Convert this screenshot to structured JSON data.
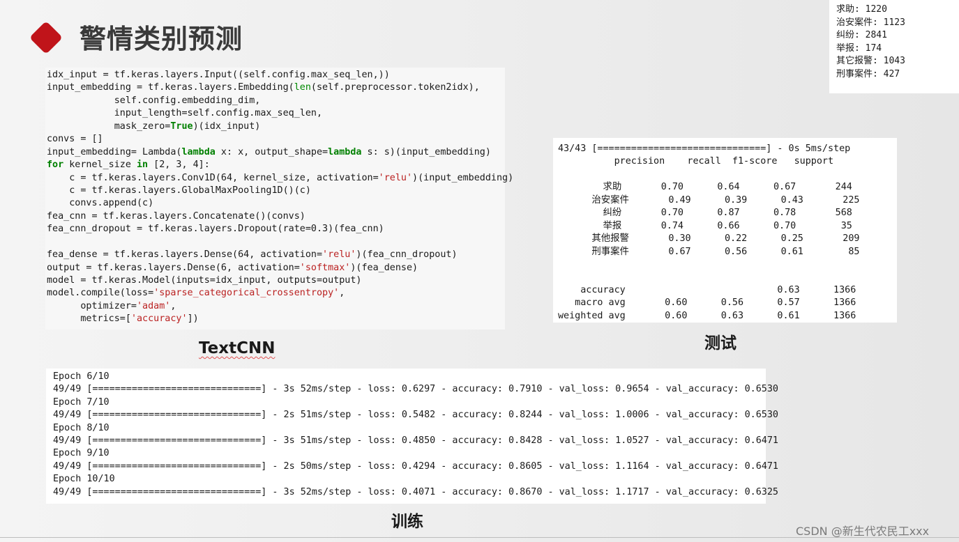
{
  "slide": {
    "title": "警情类别预测",
    "icon": "red-diamond-bullet",
    "accent_color": "#c0141a"
  },
  "class_counts": [
    "求助: 1220",
    "治安案件: 1123",
    "纠纷: 2841",
    "举报: 174",
    "其它报警: 1043",
    "刑事案件: 427"
  ],
  "code_lines": [
    [
      [
        "t",
        "idx_input = tf.keras.layers.Input((self.config.max_seq_len,))"
      ]
    ],
    [
      [
        "t",
        "input_embedding = tf.keras.layers.Embedding("
      ],
      [
        "n",
        "len"
      ],
      [
        "t",
        "(self.preprocessor.token2idx),"
      ]
    ],
    [
      [
        "t",
        "            self.config.embedding_dim,"
      ]
    ],
    [
      [
        "t",
        "            input_length=self.config.max_seq_len,"
      ]
    ],
    [
      [
        "t",
        "            mask_zero="
      ],
      [
        "k",
        "True"
      ],
      [
        "t",
        ")(idx_input)"
      ]
    ],
    [
      [
        "t",
        "convs = []"
      ]
    ],
    [
      [
        "t",
        "input_embedding= Lambda("
      ],
      [
        "k",
        "lambda"
      ],
      [
        "t",
        " x: x, output_shape="
      ],
      [
        "k",
        "lambda"
      ],
      [
        "t",
        " s: s)(input_embedding)"
      ]
    ],
    [
      [
        "k",
        "for"
      ],
      [
        "t",
        " kernel_size "
      ],
      [
        "k",
        "in"
      ],
      [
        "t",
        " [2, 3, 4]:"
      ]
    ],
    [
      [
        "t",
        "    c = tf.keras.layers.Conv1D(64, kernel_size, activation="
      ],
      [
        "s",
        "'relu'"
      ],
      [
        "t",
        ")(input_embedding)"
      ]
    ],
    [
      [
        "t",
        "    c = tf.keras.layers.GlobalMaxPooling1D()(c)"
      ]
    ],
    [
      [
        "t",
        "    convs.append(c)"
      ]
    ],
    [
      [
        "t",
        "fea_cnn = tf.keras.layers.Concatenate()(convs)"
      ]
    ],
    [
      [
        "t",
        "fea_cnn_dropout = tf.keras.layers.Dropout(rate=0.3)(fea_cnn)"
      ]
    ],
    [
      [
        "t",
        ""
      ]
    ],
    [
      [
        "t",
        "fea_dense = tf.keras.layers.Dense(64, activation="
      ],
      [
        "s",
        "'relu'"
      ],
      [
        "t",
        ")(fea_cnn_dropout)"
      ]
    ],
    [
      [
        "t",
        "output = tf.keras.layers.Dense(6, activation="
      ],
      [
        "s",
        "'softmax'"
      ],
      [
        "t",
        ")(fea_dense)"
      ]
    ],
    [
      [
        "t",
        "model = tf.keras.Model(inputs=idx_input, outputs=output)"
      ]
    ],
    [
      [
        "t",
        "model.compile(loss="
      ],
      [
        "s",
        "'sparse_categorical_crossentropy'"
      ],
      [
        "t",
        ","
      ]
    ],
    [
      [
        "t",
        "      optimizer="
      ],
      [
        "s",
        "'adam'"
      ],
      [
        "t",
        ","
      ]
    ],
    [
      [
        "t",
        "      metrics=["
      ],
      [
        "s",
        "'accuracy'"
      ],
      [
        "t",
        "])"
      ]
    ]
  ],
  "test_report_lines": [
    "43/43 [==============================] - 0s 5ms/step",
    "          precision    recall  f1-score   support",
    "",
    "        求助       0.70      0.64      0.67       244",
    "      治安案件       0.49      0.39      0.43       225",
    "        纠纷       0.70      0.87      0.78       568",
    "        举报       0.74      0.66      0.70        35",
    "      其他报警       0.30      0.22      0.25       209",
    "      刑事案件       0.67      0.56      0.61        85",
    "",
    "",
    "    accuracy                           0.63      1366",
    "   macro avg       0.60      0.56      0.57      1366",
    "weighted avg       0.60      0.63      0.61      1366"
  ],
  "training_log_lines": [
    "Epoch 6/10",
    "49/49 [==============================] - 3s 52ms/step - loss: 0.6297 - accuracy: 0.7910 - val_loss: 0.9654 - val_accuracy: 0.6530",
    "Epoch 7/10",
    "49/49 [==============================] - 2s 51ms/step - loss: 0.5482 - accuracy: 0.8244 - val_loss: 1.0006 - val_accuracy: 0.6530",
    "Epoch 8/10",
    "49/49 [==============================] - 3s 51ms/step - loss: 0.4850 - accuracy: 0.8428 - val_loss: 1.0527 - val_accuracy: 0.6471",
    "Epoch 9/10",
    "49/49 [==============================] - 2s 50ms/step - loss: 0.4294 - accuracy: 0.8605 - val_loss: 1.1164 - val_accuracy: 0.6471",
    "Epoch 10/10",
    "49/49 [==============================] - 3s 52ms/step - loss: 0.4071 - accuracy: 0.8670 - val_loss: 1.1717 - val_accuracy: 0.6325"
  ],
  "captions": {
    "code": "TextCNN",
    "test": "测试",
    "train": "训练"
  },
  "watermark": "CSDN @新生代农民工xxx"
}
